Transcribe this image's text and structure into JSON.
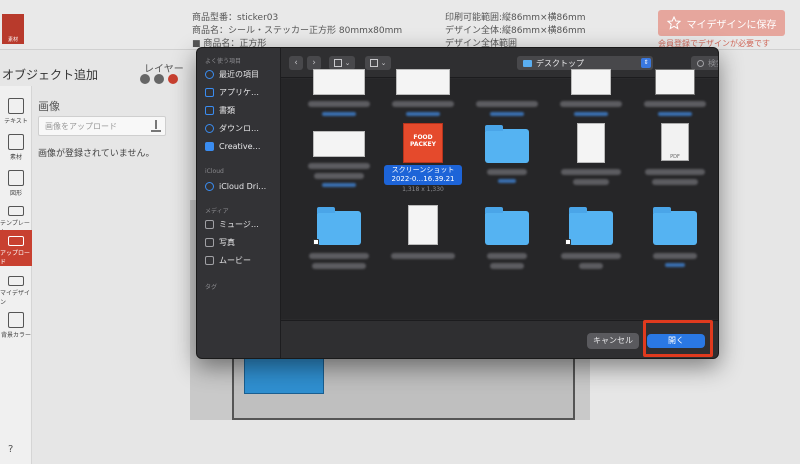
{
  "editor": {
    "logo_text": "素材",
    "product_code": "商品型番：sticker03",
    "product_name": "商品名：シール・ステッカー正方形 80mmx80mm",
    "product_extra": "■ 商品名：正方形",
    "print_range": "印刷可能範囲:縦86mm×横86mm",
    "design_total": "デザイン全体:縦86mm×横86mm",
    "design_extra": "デザイン全体範囲",
    "save_button": "マイデザインに保存",
    "save_note": "会員登録でデザインが必要です",
    "panel_title": "オブジェクト追加",
    "layer_label": "レイヤー",
    "section_title": "画像",
    "upload_placeholder": "画像をアップロード",
    "empty_message": "画像が登録されていません。",
    "help": "?",
    "tools": [
      {
        "label": "テキスト",
        "icon": "text-icon"
      },
      {
        "label": "素材",
        "icon": "brush-icon"
      },
      {
        "label": "図形",
        "icon": "shape-icon"
      },
      {
        "label": "テンプレート",
        "icon": "template-icon"
      },
      {
        "label": "アップロード",
        "icon": "upload-icon"
      },
      {
        "label": "マイデザイン",
        "icon": "person-icon"
      },
      {
        "label": "背景カラー",
        "icon": "bucket-icon"
      }
    ]
  },
  "dialog": {
    "toolbar": {
      "back": "‹",
      "forward": "›",
      "location": "デスクトップ",
      "search_placeholder": "検索"
    },
    "sidebar": {
      "favorites_head": "よく使う項目",
      "favorites": [
        {
          "label": "最近の項目",
          "icon": "clock-icon"
        },
        {
          "label": "アプリケ…",
          "icon": "apps-icon"
        },
        {
          "label": "書類",
          "icon": "document-icon"
        },
        {
          "label": "ダウンロ…",
          "icon": "download-icon"
        },
        {
          "label": "Creative…",
          "icon": "folder-icon"
        }
      ],
      "icloud_head": "iCloud",
      "icloud": [
        {
          "label": "iCloud Dri…",
          "icon": "cloud-icon"
        }
      ],
      "media_head": "メディア",
      "media": [
        {
          "label": "ミュージ…",
          "icon": "music-icon"
        },
        {
          "label": "写真",
          "icon": "camera-icon"
        },
        {
          "label": "ムービー",
          "icon": "film-icon"
        }
      ],
      "tags_head": "タグ"
    },
    "selected_file": {
      "thumb_text": "FOOD PACKEY",
      "name_line1": "スクリーンショット",
      "name_line2": "2022-0…16.39.21",
      "size": "1,318 x 1,330"
    },
    "pdf_label": "PDF",
    "cancel_button": "キャンセル",
    "open_button": "開く"
  }
}
